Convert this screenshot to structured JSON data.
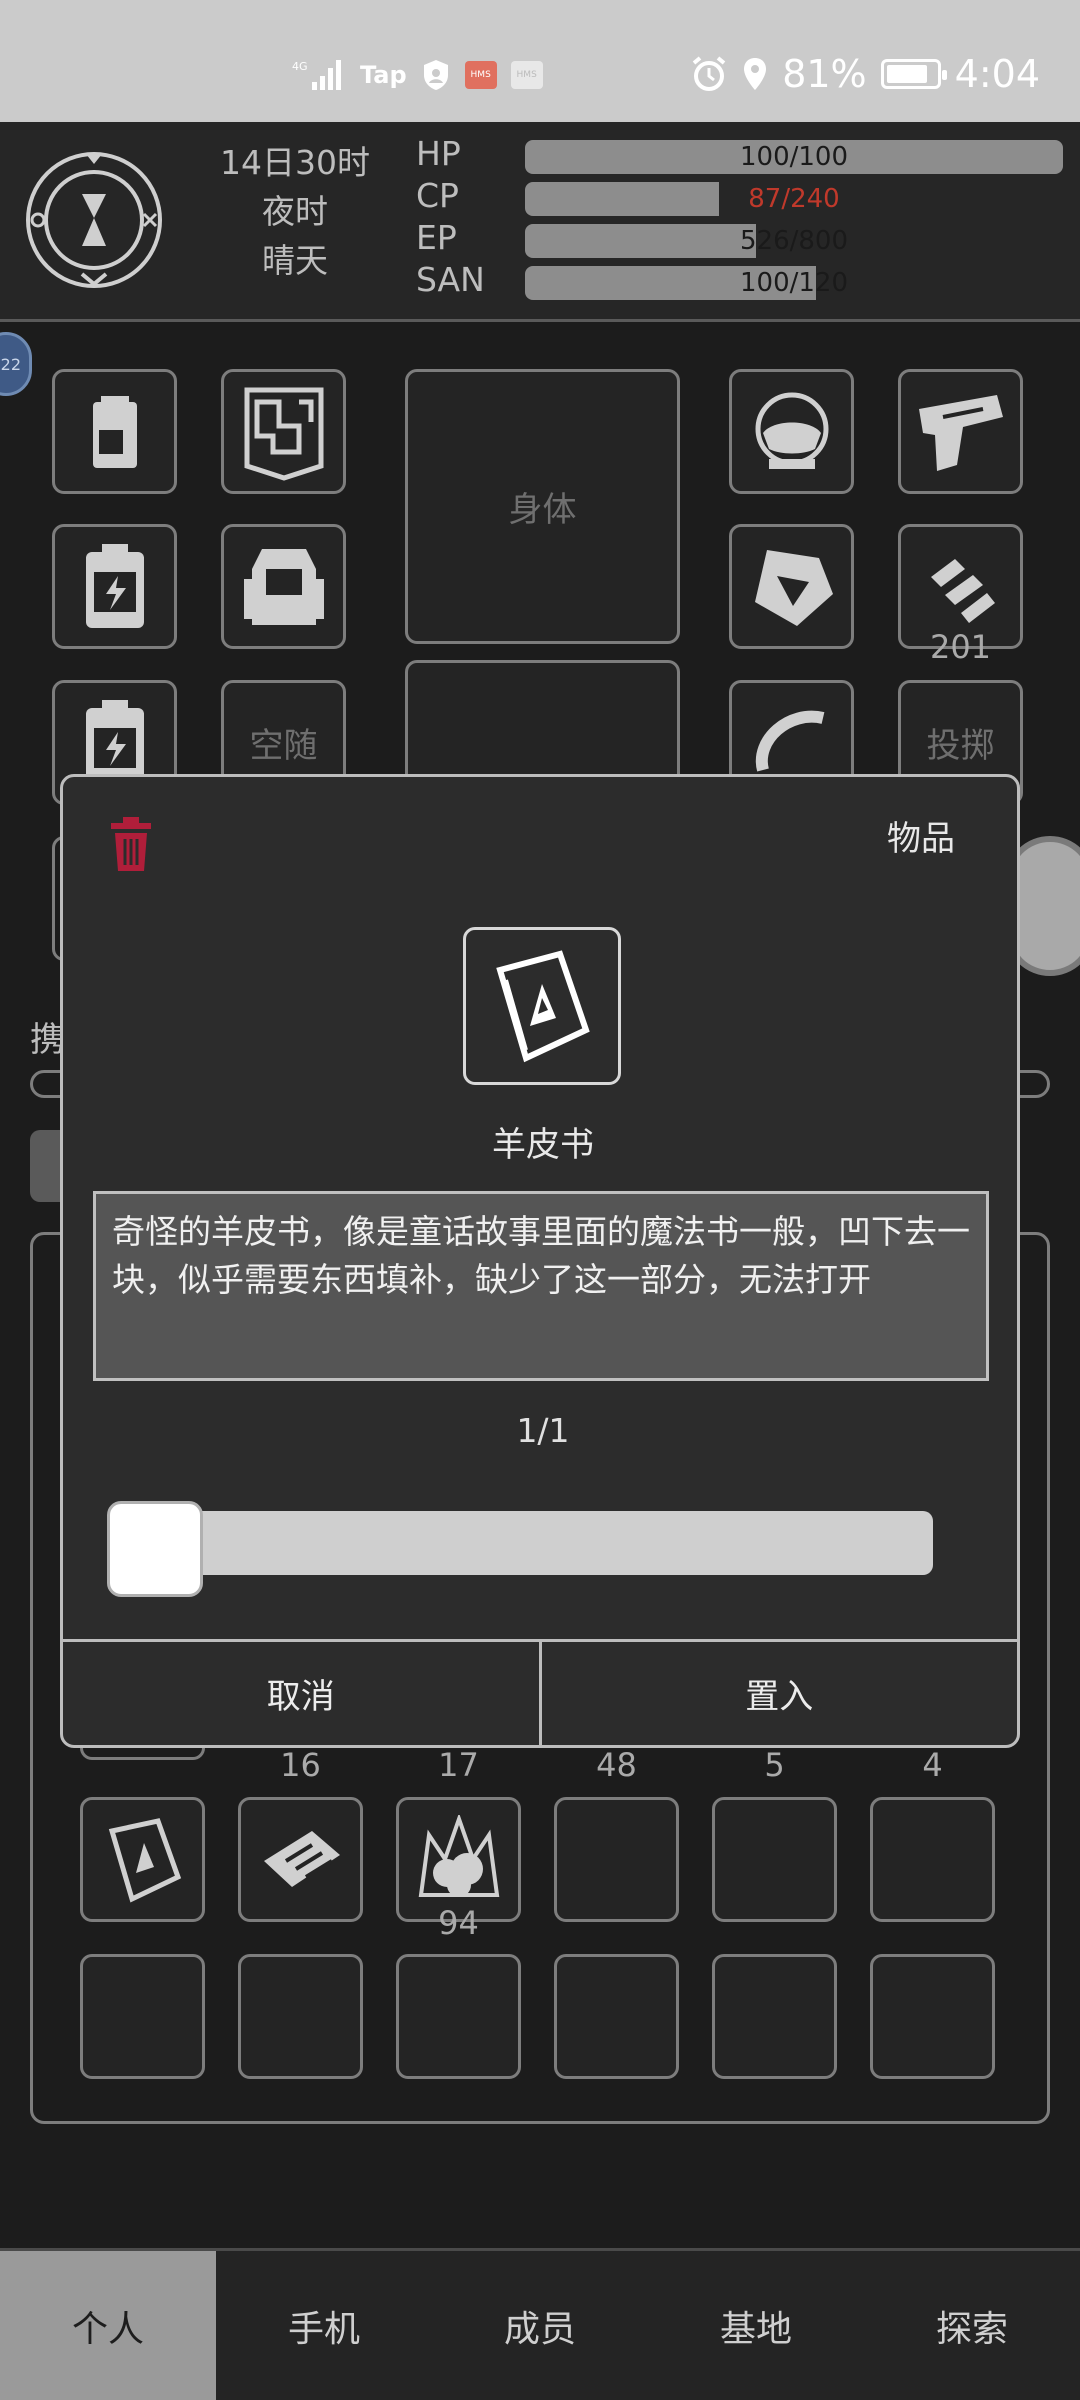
{
  "status_bar": {
    "network": "4G",
    "app_label": "Tap",
    "hms_badge": "HMS",
    "battery_percent": "81%",
    "time": "4:04"
  },
  "hud": {
    "day_hour": "14日30时",
    "period": "夜时",
    "weather": "晴天",
    "stats": [
      {
        "label": "HP",
        "text": "100/100",
        "fill": 1.0
      },
      {
        "label": "CP",
        "text": "87/240",
        "fill": 0.36
      },
      {
        "label": "EP",
        "text": "526/800",
        "fill": 0.43
      },
      {
        "label": "SAN",
        "text": "100/120",
        "fill": 0.54
      }
    ]
  },
  "equipment": {
    "body_label": "身体",
    "empty_slot_label": "空随",
    "throw_label": "投掷",
    "ammo_count": "201",
    "carry_partial": "携",
    "side_badge": "22"
  },
  "inventory": {
    "counts_row": [
      "16",
      "17",
      "48",
      "5",
      "4"
    ],
    "item_count_fire": "94"
  },
  "modal": {
    "category": "物品",
    "item_name": "羊皮书",
    "description": "奇怪的羊皮书，像是童话故事里面的魔法书一般，凹下去一块，似乎需要东西填补，缺少了这一部分，无法打开",
    "quantity": "1/1",
    "slider_value": 0,
    "cancel_label": "取消",
    "confirm_label": "置入",
    "delete_color": "#b01e3a"
  },
  "nav": {
    "tabs": [
      "个人",
      "手机",
      "成员",
      "基地",
      "探索"
    ],
    "active": "个人"
  },
  "colors": {
    "accent_red_text": "#c0392b",
    "background": "#1c1c1c"
  }
}
